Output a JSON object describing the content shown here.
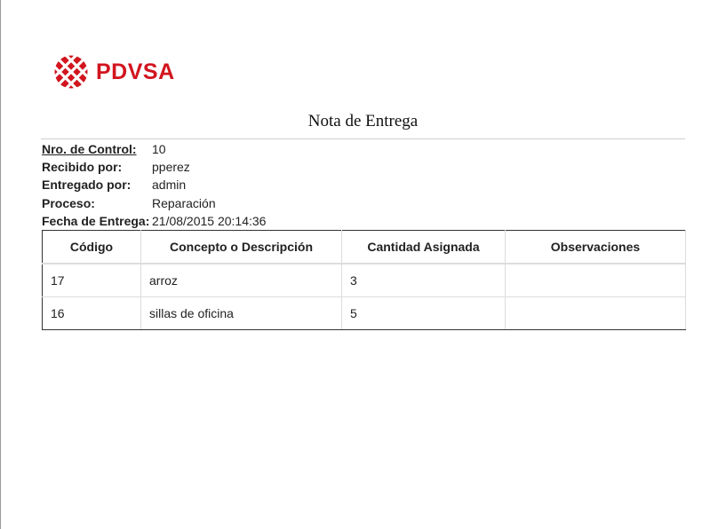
{
  "brand": {
    "logo_text": "PDVSA",
    "color": "#d2151f",
    "logo_icon": "pdvsa-sun-icon"
  },
  "document": {
    "title": "Nota de Entrega"
  },
  "info": {
    "control_label": "Nro. de Control:",
    "control_value": "10",
    "received_label": "Recibido por:",
    "received_value": "pperez",
    "delivered_label": "Entregado por:",
    "delivered_value": "admin",
    "process_label": "Proceso:",
    "process_value": "Reparación",
    "date_label": "Fecha de Entrega:",
    "date_value": "21/08/2015 20:14:36"
  },
  "table": {
    "headers": [
      "Código",
      "Concepto o Descripción",
      "Cantidad Asignada",
      "Observaciones"
    ],
    "rows": [
      {
        "codigo": "17",
        "concepto": "arroz",
        "cantidad": "3",
        "observaciones": ""
      },
      {
        "codigo": "16",
        "concepto": "sillas de oficina",
        "cantidad": "5",
        "observaciones": ""
      }
    ]
  }
}
